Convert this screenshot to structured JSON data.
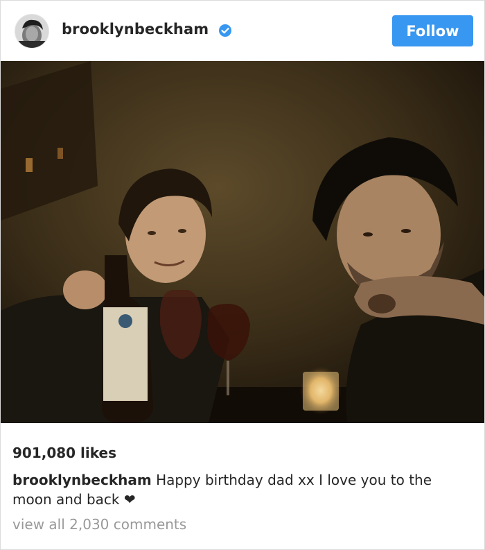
{
  "post": {
    "username": "brooklynbeckham",
    "verified": true,
    "follow_label": "Follow",
    "likes_text": "901,080 likes",
    "caption_username": "brooklynbeckham",
    "caption_text": "Happy birthday dad xx I love you to the moon and back ❤",
    "comments_text": "view all 2,030 comments"
  },
  "colors": {
    "follow_button": "#3897f0",
    "verified_badge": "#3897f0",
    "secondary_text": "#999999"
  }
}
